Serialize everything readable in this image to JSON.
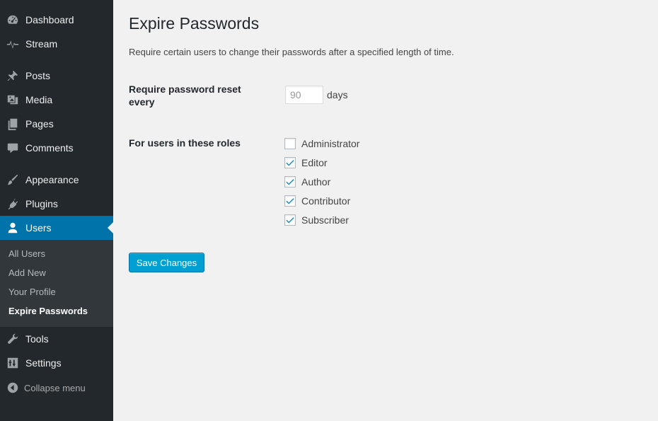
{
  "sidebar": {
    "items": [
      {
        "label": "Dashboard",
        "icon": "dashboard-icon"
      },
      {
        "label": "Stream",
        "icon": "pulse-icon"
      },
      {
        "label": "Posts",
        "icon": "pin-icon"
      },
      {
        "label": "Media",
        "icon": "media-icon"
      },
      {
        "label": "Pages",
        "icon": "pages-icon"
      },
      {
        "label": "Comments",
        "icon": "comment-icon"
      },
      {
        "label": "Appearance",
        "icon": "brush-icon"
      },
      {
        "label": "Plugins",
        "icon": "plugin-icon"
      },
      {
        "label": "Users",
        "icon": "user-icon",
        "active": true
      },
      {
        "label": "Tools",
        "icon": "wrench-icon"
      },
      {
        "label": "Settings",
        "icon": "settings-icon"
      }
    ],
    "submenu": [
      {
        "label": "All Users"
      },
      {
        "label": "Add New"
      },
      {
        "label": "Your Profile"
      },
      {
        "label": "Expire Passwords",
        "current": true
      }
    ],
    "collapse_label": "Collapse menu"
  },
  "page": {
    "title": "Expire Passwords",
    "description": "Require certain users to change their passwords after a specified length of time.",
    "reset_label": "Require password reset every",
    "days_value": "90",
    "days_suffix": "days",
    "roles_label": "For users in these roles",
    "roles": [
      {
        "label": "Administrator",
        "checked": false
      },
      {
        "label": "Editor",
        "checked": true
      },
      {
        "label": "Author",
        "checked": true
      },
      {
        "label": "Contributor",
        "checked": true
      },
      {
        "label": "Subscriber",
        "checked": true
      }
    ],
    "save_label": "Save Changes"
  },
  "colors": {
    "sidebar_bg": "#23282d",
    "submenu_bg": "#32373c",
    "accent": "#0073aa",
    "button": "#00a0d2",
    "checkmark": "#1e8cbe"
  }
}
